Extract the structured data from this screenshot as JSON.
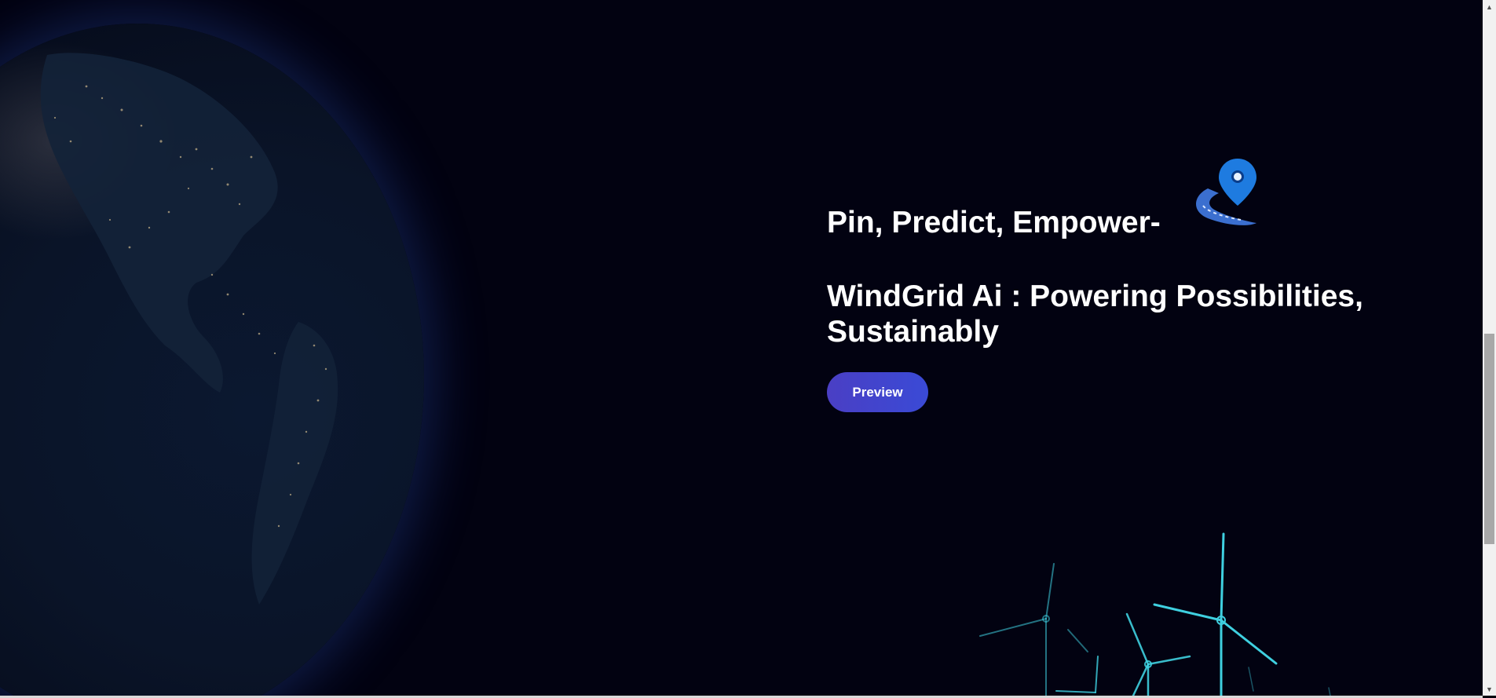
{
  "hero": {
    "tagline": "Pin, Predict, Empower-",
    "headline": "WindGrid Ai : Powering Possibilities, Sustainably",
    "preview_label": "Preview"
  },
  "icons": {
    "globe": "earth-globe-image",
    "pin": "map-pin-road-icon",
    "turbines": "wind-turbines-image",
    "scroll_up": "chevron-up-icon",
    "scroll_down": "chevron-down-icon"
  },
  "scrollbar": {
    "up_arrow": "▲",
    "down_arrow": "▼"
  },
  "colors": {
    "background": "#020211",
    "button": "#4a3fc4",
    "turbine": "#3fd0e0",
    "pin": "#1e7be0"
  }
}
